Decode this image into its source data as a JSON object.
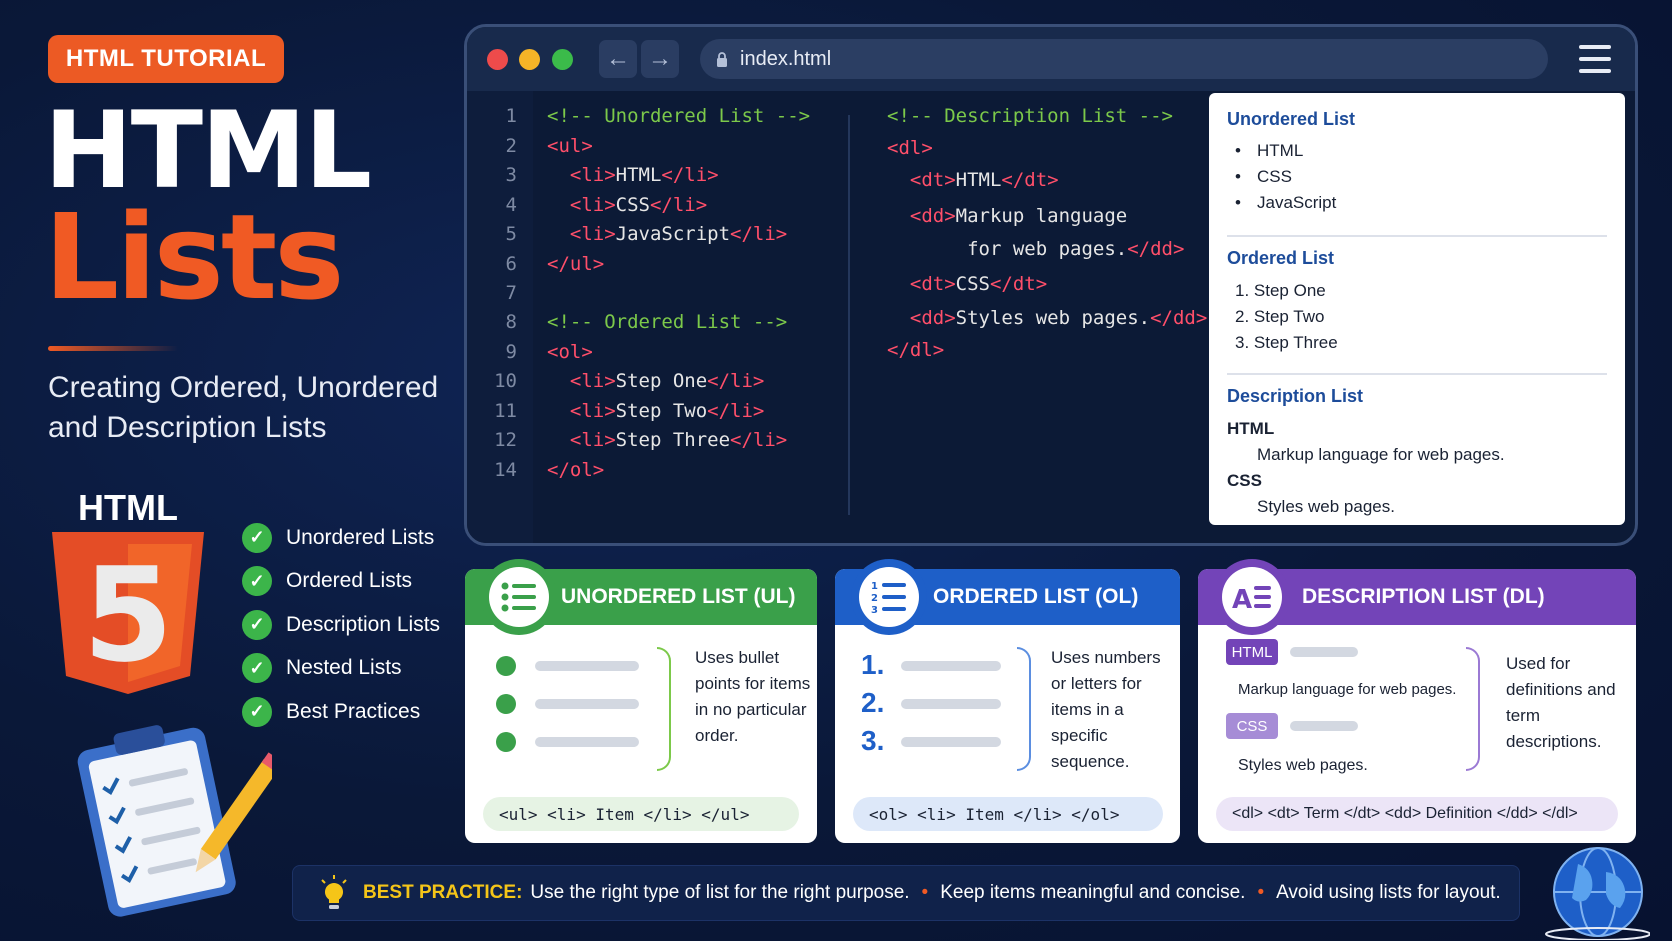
{
  "left": {
    "tag": "HTML TUTORIAL",
    "title_line1": "HTML",
    "title_line2": "Lists",
    "subtitle": "Creating Ordered, Unordered and Description Lists",
    "logo_text": "HTML",
    "logo_number": "5",
    "checklist": [
      "Unordered Lists",
      "Ordered Lists",
      "Description Lists",
      "Nested Lists",
      "Best Practices"
    ]
  },
  "browser": {
    "url": "index.html",
    "back_icon": "arrow-left-icon",
    "forward_icon": "arrow-right-icon",
    "menu_icon": "hamburger-icon",
    "line_numbers": [
      "1",
      "2",
      "3",
      "4",
      "5",
      "6",
      "7",
      "8",
      "9",
      "10",
      "11",
      "12",
      "14"
    ],
    "code_left": [
      {
        "cm": "<!-- Unordered List -->"
      },
      {
        "open": "<ul>"
      },
      {
        "open": "  <li>",
        "text": "HTML",
        "close": "</li>"
      },
      {
        "open": "  <li>",
        "text": "CSS",
        "close": "</li>"
      },
      {
        "open": "  <li>",
        "text": "JavaScript",
        "close": "</li>"
      },
      {
        "open": "</ul>"
      },
      {},
      {
        "cm": "<!-- Ordered List -->"
      },
      {
        "open": "<ol>"
      },
      {
        "open": "  <li>",
        "text": "Step One",
        "close": "</li>"
      },
      {
        "open": "  <li>",
        "text": "Step Two",
        "close": "</li>"
      },
      {
        "open": "  <li>",
        "text": "Step Three",
        "close": "</li>"
      },
      {
        "open": "</ol>"
      }
    ],
    "code_right": [
      {
        "cm": "<!-- Description List -->"
      },
      {
        "open": "<dl>"
      },
      {
        "open": "  <dt>",
        "text": "HTML",
        "close": "</dt>"
      },
      {
        "open": "  <dd>",
        "text": "Markup language"
      },
      {
        "text": "       for web pages.",
        "close": "</dd>"
      },
      {
        "open": "  <dt>",
        "text": "CSS",
        "close": "</dt>"
      },
      {
        "open": "  <dd>",
        "text": "Styles web pages.",
        "close": "</dd>"
      },
      {
        "open": "</dl>"
      }
    ],
    "preview": {
      "ul_heading": "Unordered List",
      "ul_items": [
        "HTML",
        "CSS",
        "JavaScript"
      ],
      "ol_heading": "Ordered List",
      "ol_items": [
        "1.  Step One",
        "2.  Step Two",
        "3.  Step Three"
      ],
      "dl_heading": "Description List",
      "dl_term1": "HTML",
      "dl_def1": "Markup language for web pages.",
      "dl_term2": "CSS",
      "dl_def2": "Styles web pages."
    }
  },
  "cards": {
    "ul": {
      "title": "UNORDERED LIST (UL)",
      "color": "#3aa04a",
      "icon": "bullet-list-icon",
      "description": "Uses bullet points for items in no particular order.",
      "snippet": "<ul> <li> Item </li> </ul>"
    },
    "ol": {
      "title": "ORDERED LIST (OL)",
      "color": "#1e5fc8",
      "icon": "numbered-list-icon",
      "numbers": [
        "1.",
        "2.",
        "3."
      ],
      "description": "Uses numbers or letters for items in a specific sequence.",
      "snippet": "<ol> <li> Item </li> </ol>"
    },
    "dl": {
      "title": "DESCRIPTION LIST (DL)",
      "color": "#7344b8",
      "icon": "description-list-icon",
      "term1": "HTML",
      "def1": "Markup language for web pages.",
      "term2": "CSS",
      "def2": "Styles web pages.",
      "description": "Used for definitions and term descriptions.",
      "snippet": "<dl> <dt> Term </dt> <dd> Definition </dd> </dl>"
    }
  },
  "best_practice": {
    "label": "BEST PRACTICE:",
    "tips": [
      "Use the right type of list for the right purpose.",
      "Keep items meaningful and concise.",
      "Avoid using lists for layout."
    ],
    "bulb_icon": "lightbulb-icon"
  },
  "colors": {
    "accent_orange": "#f05a24",
    "background": "#0a1838",
    "check_green": "#3cb54a",
    "comment_green": "#7cc94a",
    "tag_red": "#ff4f6a"
  }
}
